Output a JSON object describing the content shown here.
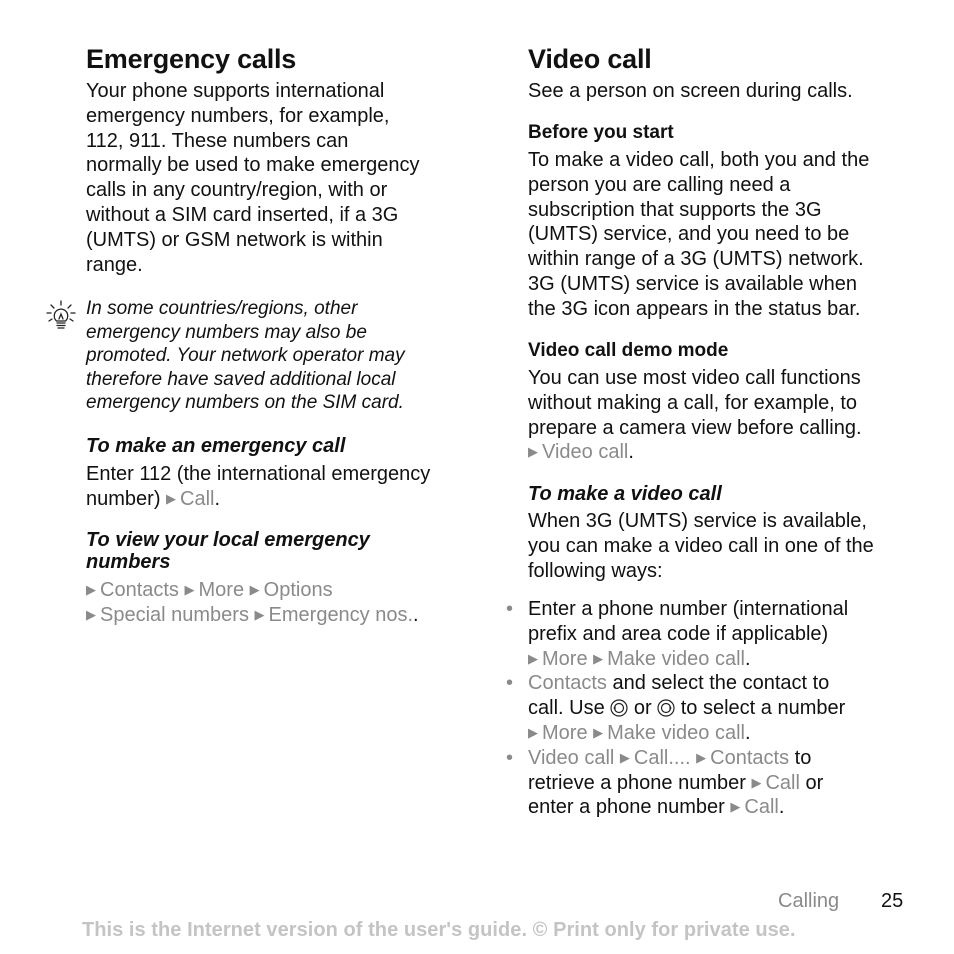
{
  "left": {
    "title": "Emergency calls",
    "intro": [
      "Your phone supports international",
      "emergency numbers, for example,",
      "112, 911. These numbers can",
      "normally be used to make emergency",
      "calls in any country/region, with or",
      "without a SIM card inserted, if a 3G",
      "(UMTS) or GSM network is within",
      "range."
    ],
    "tip_icon": "lightbulb-icon",
    "tip": [
      "In some countries/regions, other",
      "emergency numbers may also be",
      "promoted. Your network operator may",
      "therefore have saved additional local",
      "emergency numbers on the SIM card."
    ],
    "make_call": {
      "heading": "To make an emergency call",
      "text_line1": "Enter 112 (the international emergency",
      "text_line2": "number)",
      "action": "Call",
      "end": "."
    },
    "view_numbers": {
      "heading_line1": "To view your local emergency",
      "heading_line2": "numbers",
      "path_line1": [
        "Contacts",
        "More",
        "Options"
      ],
      "path_line2": [
        "Special numbers",
        "Emergency nos."
      ],
      "end": "."
    }
  },
  "right": {
    "title": "Video call",
    "intro": "See a person on screen during calls.",
    "before": {
      "heading": "Before you start",
      "text": [
        "To make a video call, both you and the",
        "person you are calling need a",
        "subscription that supports the 3G",
        "(UMTS) service, and you need to be",
        "within range of a 3G (UMTS) network.",
        "3G (UMTS) service is available when",
        "the 3G icon appears in the status bar."
      ]
    },
    "demo": {
      "heading": "Video call demo mode",
      "text": [
        "You can use most video call functions",
        "without making a call, for example, to",
        "prepare a camera view before calling."
      ],
      "action": "Video call",
      "end": "."
    },
    "make": {
      "heading": "To make a video call",
      "text": [
        "When 3G (UMTS) service is available,",
        "you can make a video call in one of the",
        "following ways:"
      ],
      "bullets": [
        {
          "line1": "Enter a phone number (international",
          "line2": "prefix and area code if applicable)",
          "path": [
            "More",
            "Make video call"
          ],
          "end": "."
        },
        {
          "link": "Contacts",
          "line1_rest": " and select the contact to",
          "line2_a": "call. Use",
          "line2_b": "or",
          "line2_c": "to select a number",
          "icon_left": "navigation-key-left-icon",
          "icon_right": "navigation-key-right-icon",
          "path": [
            "More",
            "Make video call"
          ],
          "end": "."
        },
        {
          "path_a": [
            "Video call",
            "Call....",
            "Contacts"
          ],
          "line1_rest": " to",
          "line2_text": "retrieve a phone number",
          "line2_action": "Call",
          "line2_rest": " or",
          "line3_text": "enter a phone number",
          "line3_action": "Call",
          "end": "."
        }
      ]
    }
  },
  "footer": {
    "section": "Calling",
    "page": "25",
    "notice": "This is the Internet version of the user's guide. © Print only for private use."
  },
  "colors": {
    "text": "#111111",
    "menu_path": "#8a8a8a",
    "notice": "#c4c4c4"
  }
}
